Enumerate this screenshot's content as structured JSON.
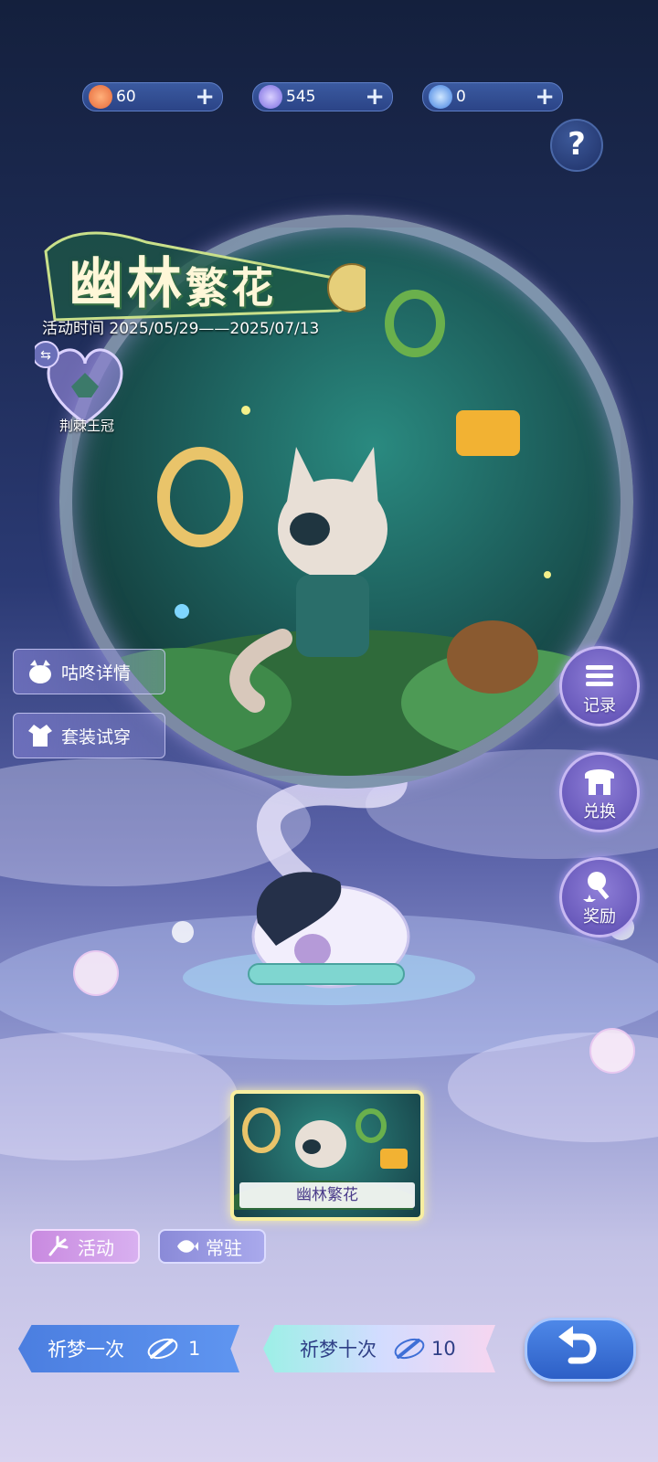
{
  "currencies": [
    {
      "icon": "sun-coin-icon",
      "value": "60",
      "color": "#f08a5a"
    },
    {
      "icon": "moon-crystal-icon",
      "value": "545",
      "color": "#9a8df0"
    },
    {
      "icon": "wish-feather-icon",
      "value": "0",
      "color": "#5aa8f0"
    }
  ],
  "help": {
    "label": "?"
  },
  "event": {
    "title_a": "幽林",
    "title_b": "繁花",
    "time": "活动时间 2025/05/29——2025/07/13"
  },
  "featured_item": {
    "label": "荆棘王冠"
  },
  "side_buttons": {
    "details": "咕咚详情",
    "try_on": "套装试穿"
  },
  "right_buttons": {
    "record": "记录",
    "exchange": "兑换",
    "reward": "奖励"
  },
  "pool_card": {
    "label": "幽林繁花"
  },
  "tabs": {
    "event": "活动",
    "permanent": "常驻"
  },
  "wish": {
    "once_label": "祈梦一次",
    "once_cost": "1",
    "ten_label": "祈梦十次",
    "ten_cost": "10"
  }
}
